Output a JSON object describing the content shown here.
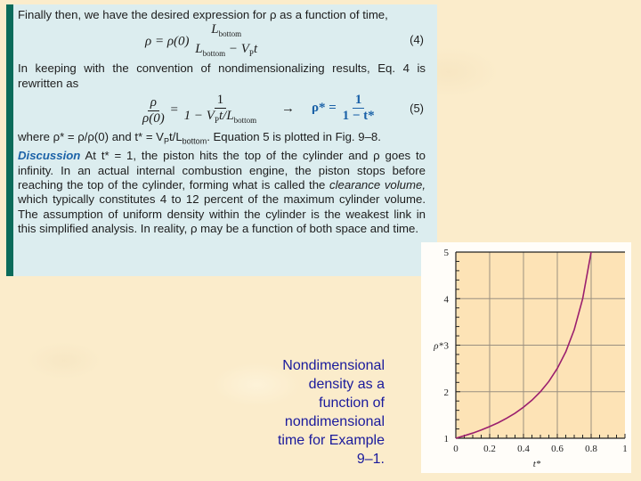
{
  "textbox": {
    "intro": "Finally then, we have the desired expression for ρ as a function of time,",
    "eq4": {
      "lhs": "ρ = ρ(0)",
      "numerator": "L",
      "numerator_sub": "bottom",
      "denominator": "L",
      "denominator_sub": "bottom",
      "denominator_rest": " − V",
      "denominator_sub2": "P",
      "denominator_tail": "t",
      "number": "(4)"
    },
    "para2": "In keeping with the convention of nondimensionalizing results, Eq. 4 is rewritten as",
    "eq5": {
      "lhs_num": "ρ",
      "lhs_den": "ρ(0)",
      "equals": "=",
      "rhs_num": "1",
      "rhs_den": "1 − V",
      "rhs_den_sub": "P",
      "rhs_den_rest": "t/L",
      "rhs_den_sub2": "bottom",
      "arrow": "→",
      "star_lhs": "ρ* =",
      "star_num": "1",
      "star_den": "1 − t*",
      "number": "(5)"
    },
    "para3_pre": "where ρ* = ρ/ρ(0) and t* = V",
    "para3_sub": "P",
    "para3_mid": "t/L",
    "para3_sub2": "bottom",
    "para3_post": ". Equation 5 is plotted in Fig. 9–8.",
    "discussion_label": "Discussion",
    "discussion_a": "  At t* = 1, the piston hits the top of the cylinder and ρ goes to infinity. In an actual internal combustion engine, the piston stops before reaching the top of the cylinder, forming what is called the ",
    "discussion_italic": "clearance volume,",
    "discussion_b": " which typically constitutes 4 to 12 percent of the maximum cylinder volume. The assumption of uniform density within the cylinder is the weakest link in this simplified analysis. In reality, ρ may be a function of both space and time."
  },
  "caption": {
    "lines": [
      "Nondimensional",
      "density as a",
      "function of",
      "nondimensional",
      "time for Example",
      "9–1."
    ]
  },
  "colors": {
    "accent_bar": "#0b6b5a",
    "textbox_bg": "#dcedef",
    "equation_blue": "#1b62a8",
    "caption_blue": "#1a1a9c",
    "plot_bg": "#fde3b6",
    "curve": "#9b1f6e"
  },
  "chart_data": {
    "type": "line",
    "title": "",
    "xlabel": "t*",
    "ylabel": "ρ*",
    "xlim": [
      0,
      1
    ],
    "ylim": [
      1,
      5
    ],
    "xticks": [
      "0",
      "0.2",
      "0.4",
      "0.6",
      "0.8",
      "1"
    ],
    "yticks": [
      "1",
      "2",
      "3",
      "4",
      "5"
    ],
    "grid": true,
    "series": [
      {
        "name": "ρ* = 1/(1 − t*)",
        "x": [
          0,
          0.05,
          0.1,
          0.15,
          0.2,
          0.25,
          0.3,
          0.35,
          0.4,
          0.45,
          0.5,
          0.55,
          0.6,
          0.65,
          0.7,
          0.75,
          0.8
        ],
        "y": [
          1,
          1.053,
          1.111,
          1.176,
          1.25,
          1.333,
          1.429,
          1.538,
          1.667,
          1.818,
          2,
          2.222,
          2.5,
          2.857,
          3.333,
          4,
          5
        ]
      }
    ]
  }
}
